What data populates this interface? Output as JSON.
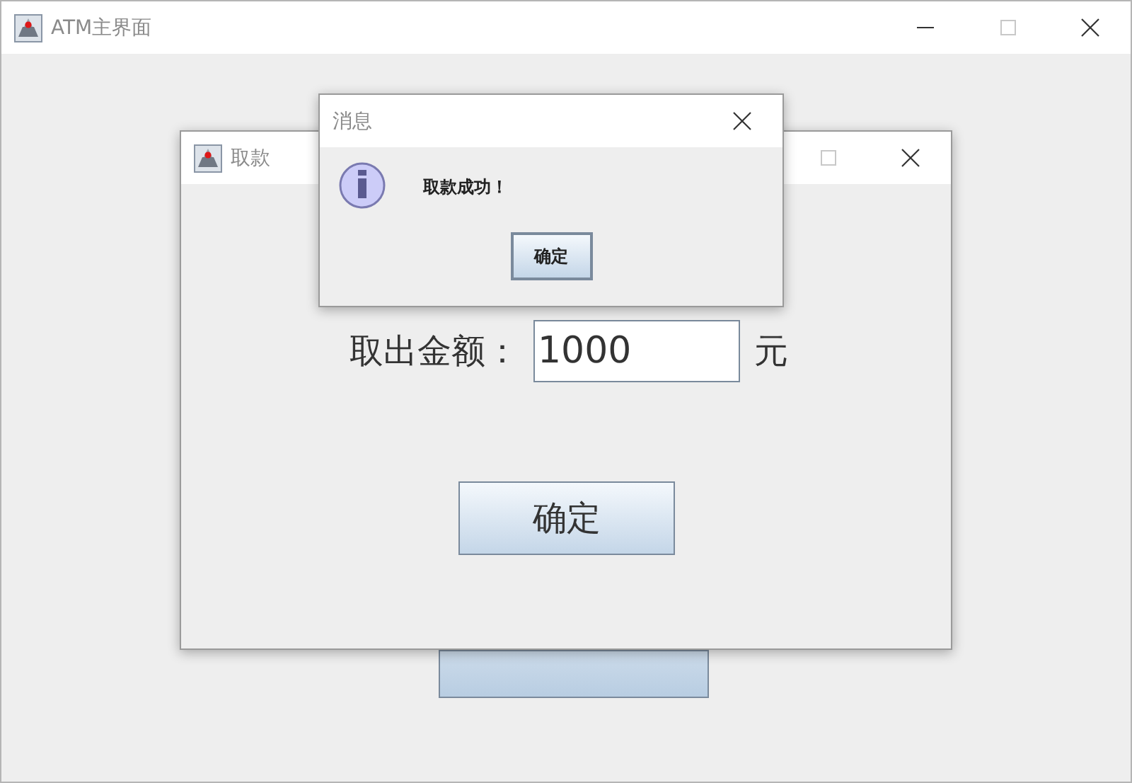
{
  "main_window": {
    "title": "ATM主界面"
  },
  "withdraw_window": {
    "title": "取款",
    "amount_label": "取出金额：",
    "amount_value": "1000",
    "unit": "元",
    "confirm_button": "确定"
  },
  "message_dialog": {
    "title": "消息",
    "message": "取款成功！",
    "ok_button": "确定"
  }
}
